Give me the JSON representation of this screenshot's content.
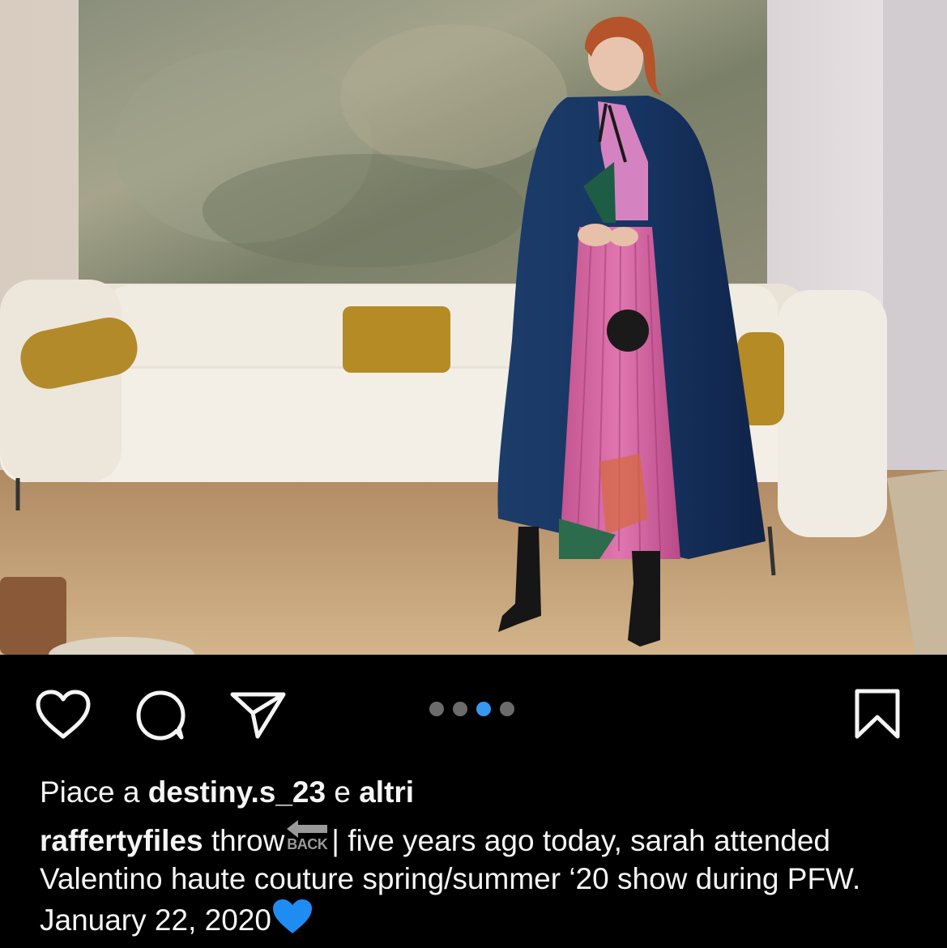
{
  "post": {
    "dots_count": 4,
    "active_dot_index": 2,
    "likes": {
      "prefix": "Piace a",
      "user": "destiny.s_23",
      "connector": "e",
      "others": "altri"
    },
    "caption": {
      "username": "raffertyfiles",
      "word_before_emoji": "throw",
      "emoji_label": "BACK",
      "text": "| five years ago today, sarah attended Valentino haute couture spring/summer ‘20 show during PFW. January 22, 2020",
      "trailing_emoji": "blue-heart"
    }
  },
  "icons": {
    "like": "heart-outline-icon",
    "comment": "comment-bubble-icon",
    "share": "paper-plane-icon",
    "save": "bookmark-icon"
  },
  "colors": {
    "background": "#000000",
    "text": "#f5f5f5",
    "active_dot": "#3897f0",
    "inactive_dot": "#6b6b6b",
    "heart_emoji": "#1f8cf2"
  }
}
